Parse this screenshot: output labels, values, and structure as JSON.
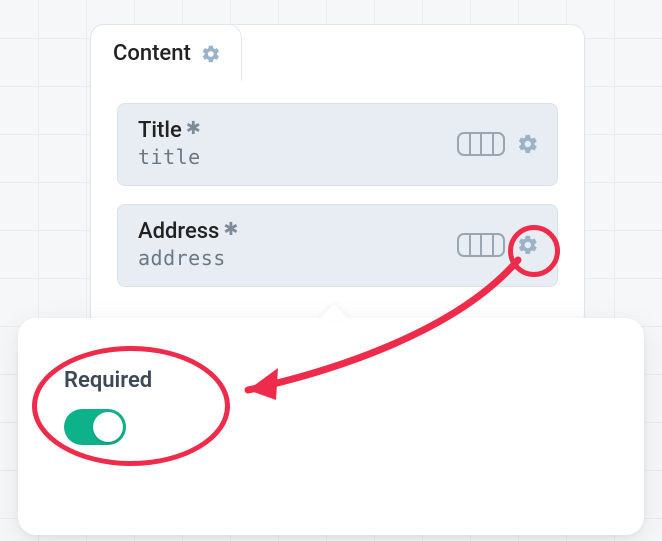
{
  "tab": {
    "label": "Content"
  },
  "fields": [
    {
      "label": "Title",
      "slug": "title",
      "required": true
    },
    {
      "label": "Address",
      "slug": "address",
      "required": true
    }
  ],
  "popover": {
    "required_label": "Required",
    "required_on": true
  },
  "colors": {
    "gear": "#9bb3c9",
    "accent_red": "#ee2b4a",
    "toggle_on": "#0db28a"
  }
}
